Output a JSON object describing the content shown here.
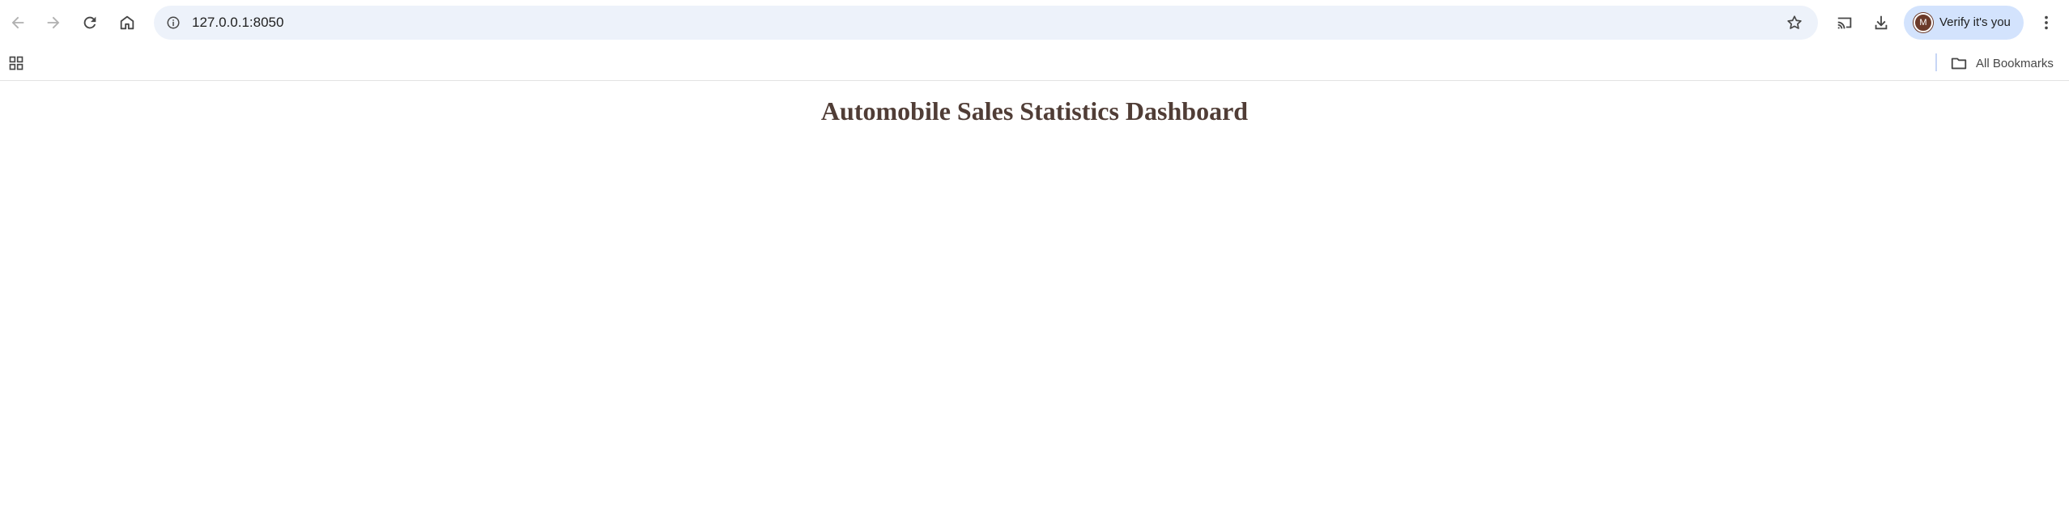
{
  "browser": {
    "url": "127.0.0.1:8050",
    "profile": {
      "initial": "M",
      "label": "Verify it's you"
    },
    "bookmarks": {
      "all_bookmarks_label": "All Bookmarks"
    },
    "icons": {
      "back": "arrow-left-icon",
      "forward": "arrow-right-icon",
      "reload": "reload-icon",
      "home": "home-icon",
      "site_info": "info-icon",
      "bookmark_star": "star-icon",
      "cast": "cast-icon",
      "downloads": "download-icon",
      "menu": "more-vertical-icon",
      "apps": "apps-grid-icon",
      "folder": "folder-icon"
    }
  },
  "page": {
    "title": "Automobile Sales Statistics Dashboard",
    "title_color": "#503d36"
  }
}
